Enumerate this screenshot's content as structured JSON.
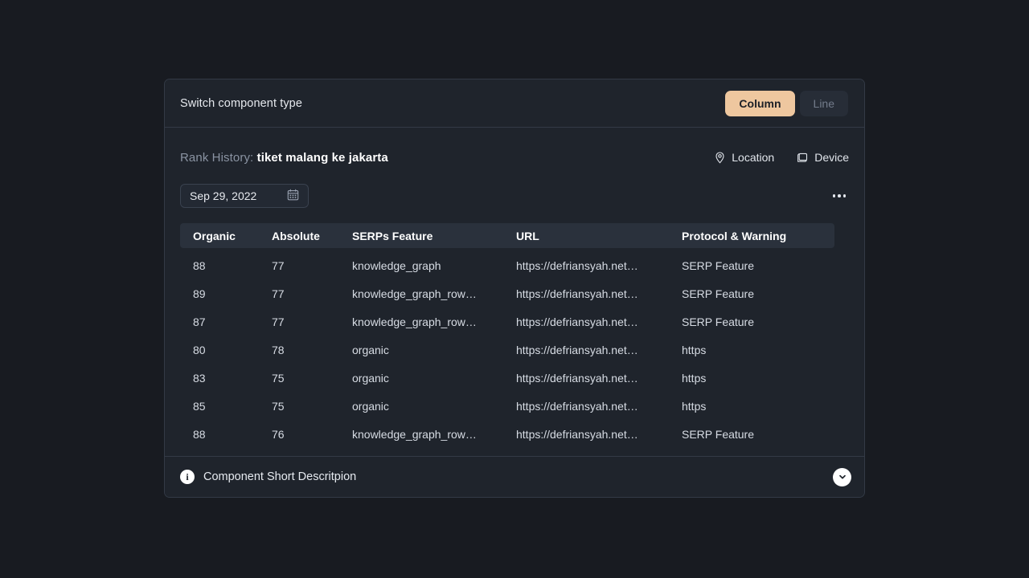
{
  "switch_bar": {
    "label": "Switch component type",
    "options": [
      {
        "label": "Column",
        "active": true
      },
      {
        "label": "Line",
        "active": false
      }
    ],
    "active_color": "#eec79f"
  },
  "header": {
    "title_prefix": "Rank History:",
    "keyword": "tiket malang ke jakarta",
    "actions": [
      {
        "label": "Location",
        "icon": "location-pin-icon"
      },
      {
        "label": "Device",
        "icon": "device-monitor-icon"
      }
    ]
  },
  "controls": {
    "date_value": "Sep 29, 2022",
    "date_icon": "calendar-icon",
    "more_icon": "kebab-menu-icon"
  },
  "table": {
    "columns": [
      "Organic",
      "Absolute",
      "SERPs Feature",
      "URL",
      "Protocol & Warning"
    ],
    "rows": [
      {
        "organic": "88",
        "absolute": "77",
        "serps": "knowledge_graph",
        "url": "https://defriansyah.net…",
        "protocol": "SERP Feature"
      },
      {
        "organic": "89",
        "absolute": "77",
        "serps": "knowledge_graph_row…",
        "url": "https://defriansyah.net…",
        "protocol": "SERP Feature"
      },
      {
        "organic": "87",
        "absolute": "77",
        "serps": "knowledge_graph_row…",
        "url": "https://defriansyah.net…",
        "protocol": "SERP Feature"
      },
      {
        "organic": "80",
        "absolute": "78",
        "serps": "organic",
        "url": "https://defriansyah.net…",
        "protocol": "https"
      },
      {
        "organic": "83",
        "absolute": "75",
        "serps": "organic",
        "url": "https://defriansyah.net…",
        "protocol": "https"
      },
      {
        "organic": "85",
        "absolute": "75",
        "serps": "organic",
        "url": "https://defriansyah.net…",
        "protocol": "https"
      },
      {
        "organic": "88",
        "absolute": "76",
        "serps": "knowledge_graph_row…",
        "url": "https://defriansyah.net…",
        "protocol": "SERP Feature"
      }
    ]
  },
  "footer": {
    "text": "Component Short Descritpion",
    "info_icon": "info-icon",
    "expand_icon": "chevron-down-icon"
  }
}
